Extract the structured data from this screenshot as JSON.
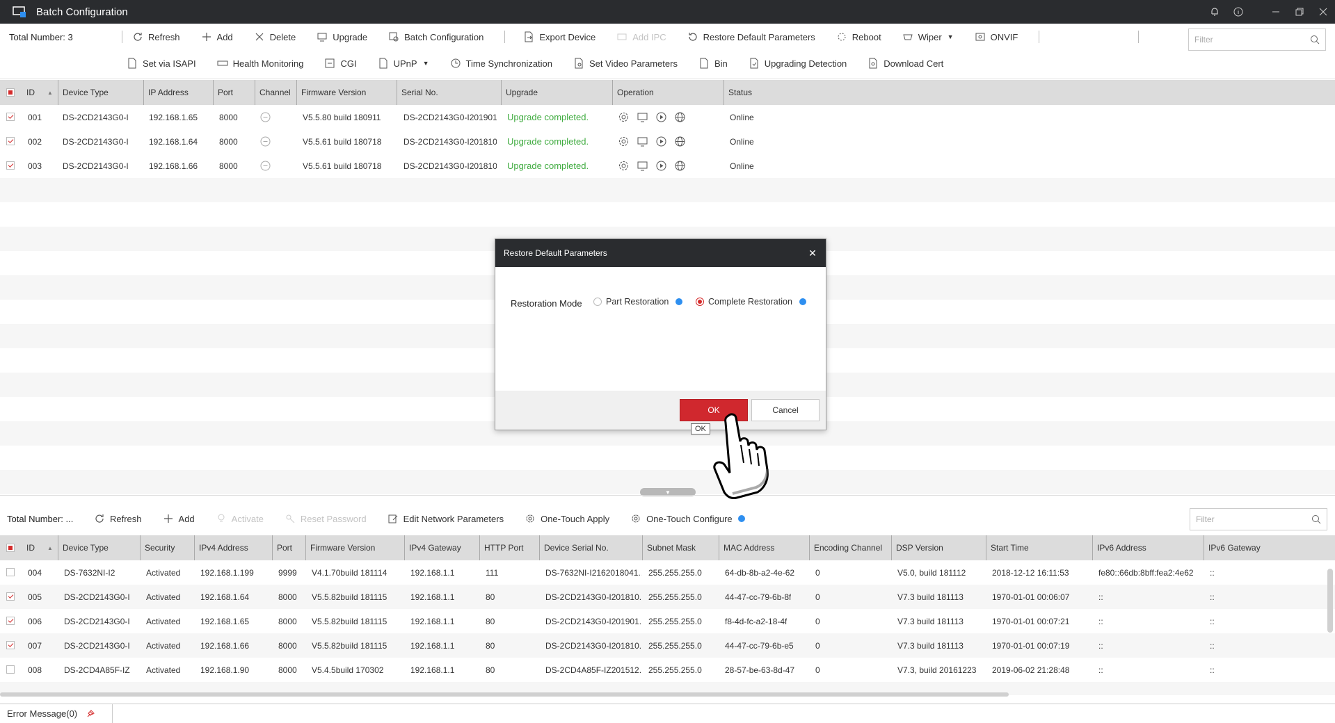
{
  "app": {
    "title": "Batch Configuration"
  },
  "toolbar": {
    "total": "Total Number: 3",
    "row1": [
      "Refresh",
      "Add",
      "Delete",
      "Upgrade",
      "Batch Configuration",
      "Export Device",
      "Add IPC",
      "Restore Default Parameters",
      "Reboot",
      "Wiper",
      "ONVIF"
    ],
    "row2": [
      "Set via ISAPI",
      "Health Monitoring",
      "CGI",
      "UPnP",
      "Time Synchronization",
      "Set Video Parameters",
      "Bin",
      "Upgrading Detection",
      "Download Cert"
    ],
    "filter_placeholder": "Filter"
  },
  "top_table": {
    "headers": [
      "ID",
      "Device Type",
      "IP Address",
      "Port",
      "Channel",
      "Firmware Version",
      "Serial No.",
      "Upgrade",
      "Operation",
      "Status"
    ],
    "rows": [
      {
        "id": "001",
        "type": "DS-2CD2143G0-I",
        "ip": "192.168.1.65",
        "port": "8000",
        "fw": "V5.5.80 build 180911",
        "serial": "DS-2CD2143G0-I201901...",
        "upgrade": "Upgrade completed.",
        "status": "Online",
        "checked": true
      },
      {
        "id": "002",
        "type": "DS-2CD2143G0-I",
        "ip": "192.168.1.64",
        "port": "8000",
        "fw": "V5.5.61 build 180718",
        "serial": "DS-2CD2143G0-I201810...",
        "upgrade": "Upgrade completed.",
        "status": "Online",
        "checked": true
      },
      {
        "id": "003",
        "type": "DS-2CD2143G0-I",
        "ip": "192.168.1.66",
        "port": "8000",
        "fw": "V5.5.61 build 180718",
        "serial": "DS-2CD2143G0-I201810...",
        "upgrade": "Upgrade completed.",
        "status": "Online",
        "checked": true
      }
    ]
  },
  "bottom_toolbar": {
    "total": "Total Number: ...",
    "items": [
      "Refresh",
      "Add",
      "Activate",
      "Reset Password",
      "Edit Network Parameters",
      "One-Touch Apply",
      "One-Touch Configure"
    ],
    "filter_placeholder": "Filter"
  },
  "bottom_table": {
    "headers": [
      "ID",
      "Device Type",
      "Security",
      "IPv4 Address",
      "Port",
      "Firmware Version",
      "IPv4 Gateway",
      "HTTP Port",
      "Device Serial No.",
      "Subnet Mask",
      "MAC Address",
      "Encoding Channel",
      "DSP Version",
      "Start Time",
      "IPv6 Address",
      "IPv6 Gateway"
    ],
    "rows": [
      {
        "checked": false,
        "cells": [
          "004",
          "DS-7632NI-I2",
          "Activated",
          "192.168.1.199",
          "9999",
          "V4.1.70build 181114",
          "192.168.1.1",
          "111",
          "DS-7632NI-I2162018041...",
          "255.255.255.0",
          "64-db-8b-a2-4e-62",
          "0",
          "V5.0, build 181112",
          "2018-12-12 16:11:53",
          "fe80::66db:8bff:fea2:4e62",
          "::"
        ]
      },
      {
        "checked": true,
        "cells": [
          "005",
          "DS-2CD2143G0-I",
          "Activated",
          "192.168.1.64",
          "8000",
          "V5.5.82build 181115",
          "192.168.1.1",
          "80",
          "DS-2CD2143G0-I201810...",
          "255.255.255.0",
          "44-47-cc-79-6b-8f",
          "0",
          "V7.3 build 181113",
          "1970-01-01 00:06:07",
          "::",
          "::"
        ]
      },
      {
        "checked": true,
        "cells": [
          "006",
          "DS-2CD2143G0-I",
          "Activated",
          "192.168.1.65",
          "8000",
          "V5.5.82build 181115",
          "192.168.1.1",
          "80",
          "DS-2CD2143G0-I201901...",
          "255.255.255.0",
          "f8-4d-fc-a2-18-4f",
          "0",
          "V7.3 build 181113",
          "1970-01-01 00:07:21",
          "::",
          "::"
        ]
      },
      {
        "checked": true,
        "cells": [
          "007",
          "DS-2CD2143G0-I",
          "Activated",
          "192.168.1.66",
          "8000",
          "V5.5.82build 181115",
          "192.168.1.1",
          "80",
          "DS-2CD2143G0-I201810...",
          "255.255.255.0",
          "44-47-cc-79-6b-e5",
          "0",
          "V7.3 build 181113",
          "1970-01-01 00:07:19",
          "::",
          "::"
        ]
      },
      {
        "checked": false,
        "cells": [
          "008",
          "DS-2CD4A85F-IZ",
          "Activated",
          "192.168.1.90",
          "8000",
          "V5.4.5build 170302",
          "192.168.1.1",
          "80",
          "DS-2CD4A85F-IZ201512...",
          "255.255.255.0",
          "28-57-be-63-8d-47",
          "0",
          "V7.3, build 20161223",
          "2019-06-02 21:28:48",
          "::",
          "::"
        ]
      }
    ]
  },
  "status_bar": {
    "error_tab": "Error Message(0)"
  },
  "modal": {
    "title": "Restore Default Parameters",
    "label": "Restoration Mode",
    "options": [
      "Part Restoration",
      "Complete Restoration"
    ],
    "selected": "Complete Restoration",
    "ok": "OK",
    "cancel": "Cancel",
    "tooltip": "OK"
  },
  "colors": {
    "accent_red": "#d0282e",
    "success_green": "#3fab3f",
    "titlebar": "#2a2c2f",
    "info_blue": "#2e8ff0"
  }
}
